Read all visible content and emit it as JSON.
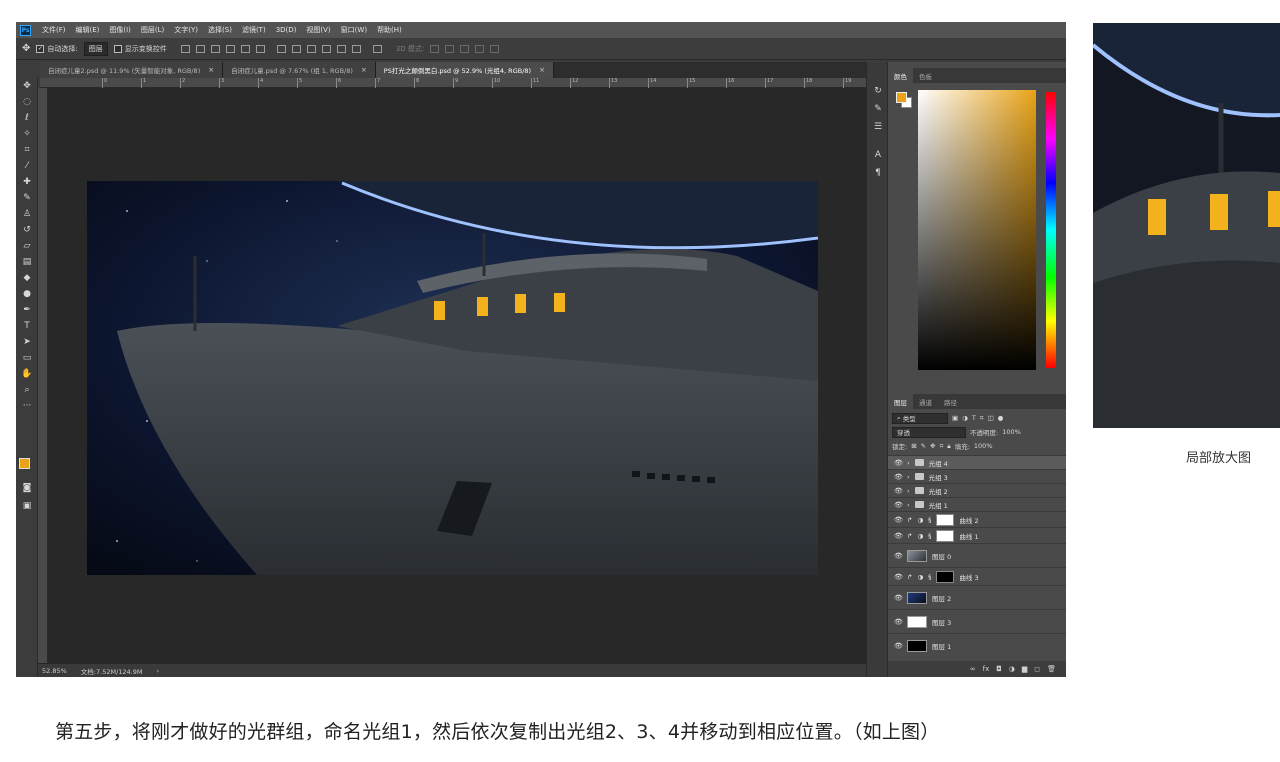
{
  "menu": {
    "logo": "Ps",
    "items": [
      "文件(F)",
      "编辑(E)",
      "图像(I)",
      "图层(L)",
      "文字(Y)",
      "选择(S)",
      "滤镜(T)",
      "3D(D)",
      "视图(V)",
      "窗口(W)",
      "帮助(H)"
    ]
  },
  "options": {
    "auto_select_label": "自动选择:",
    "auto_select_value": "图层",
    "show_transform_label": "显示变换控件",
    "mode_3d_label": "3D 模式:"
  },
  "tabs": [
    {
      "label": "自闭症儿童2.psd @ 11.9% (矢量智能对象, RGB/8)",
      "active": false
    },
    {
      "label": "自闭症儿童.psd @ 7.67% (组 1, RGB/8)",
      "active": false
    },
    {
      "label": "PS打光之颠倒黑白.psd @ 52.9% (光组4, RGB/8)",
      "active": true
    }
  ],
  "ruler": {
    "top_ticks": [
      "0",
      "1",
      "2",
      "3",
      "4",
      "5",
      "6",
      "7",
      "8",
      "9",
      "10",
      "11",
      "12",
      "13",
      "14",
      "15",
      "16",
      "17",
      "18",
      "19"
    ]
  },
  "status": {
    "zoom": "52.85%",
    "doc": "文档:7.52M/124.9M"
  },
  "color_panel": {
    "tabs": [
      "颜色",
      "色板"
    ],
    "fg_color": "#e8a317",
    "bg_color": "#ffffff"
  },
  "layers_panel": {
    "tabs": [
      "图层",
      "通道",
      "路径"
    ],
    "filter_kind": "类型",
    "blend_mode": "穿透",
    "opacity_label": "不透明度:",
    "opacity_value": "100%",
    "lock_label": "锁定:",
    "fill_label": "填充:",
    "fill_value": "100%",
    "layers": [
      {
        "name": "光组 4",
        "kind": "group",
        "selected": true
      },
      {
        "name": "光组 3",
        "kind": "group",
        "selected": false
      },
      {
        "name": "光组 2",
        "kind": "group",
        "selected": false
      },
      {
        "name": "光组 1",
        "kind": "group",
        "selected": false
      },
      {
        "name": "曲线 2",
        "kind": "adjust",
        "mask": "white"
      },
      {
        "name": "曲线 1",
        "kind": "adjust",
        "mask": "white"
      },
      {
        "name": "图层 0",
        "kind": "image",
        "thumb": "ship"
      },
      {
        "name": "曲线 3",
        "kind": "adjust",
        "mask": "black"
      },
      {
        "name": "图层 2",
        "kind": "image",
        "thumb": "space"
      },
      {
        "name": "图层 3",
        "kind": "image",
        "thumb": "white"
      },
      {
        "name": "图层 1",
        "kind": "image",
        "thumb": "black"
      }
    ]
  },
  "zoom_caption": "局部放大图",
  "instruction": "第五步，将刚才做好的光群组，命名光组1，然后依次复制出光组2、3、4并移动到相应位置。（如上图）"
}
